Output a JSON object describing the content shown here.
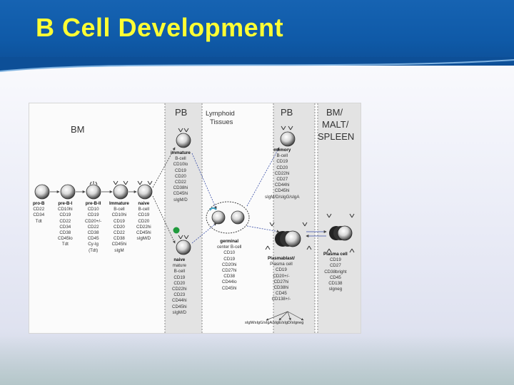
{
  "slide": {
    "title": "B Cell Development",
    "colors": {
      "header": "#1060ae",
      "title": "#ffff33",
      "panel_shade": "#e2e2e2"
    }
  },
  "diagram": {
    "columns": {
      "bm": "BM",
      "pb1": "PB",
      "lymphoid_1": "Lymphoid",
      "lymphoid_2": "Tissues",
      "pb2": "PB",
      "end_1": "BM/",
      "end_2": "MALT/",
      "end_3": "SPLEEN"
    },
    "stages": {
      "pro_b": [
        "pro-B",
        "CD22",
        "CD34",
        "Tdt"
      ],
      "pre_b1": [
        "pre-B-I",
        "CD10hi",
        "CD19",
        "CD22",
        "CD34",
        "CD38",
        "CD45lo",
        "Tdt"
      ],
      "pre_b2": [
        "pre-B-II",
        "CD10",
        "CD19",
        "CD20+/-",
        "CD22",
        "CD38",
        "CD45",
        "Cy-Ig",
        "(Tdt)"
      ],
      "immature_bm": [
        "Immature",
        "B-cell",
        "CD10hi",
        "CD19",
        "CD20",
        "CD22",
        "CD38",
        "CD45hi",
        "sIgM"
      ],
      "naive_bm": [
        "naive",
        "B-cell",
        "CD19",
        "CD20",
        "CD22hi",
        "CD45hi",
        "sIgM/D"
      ],
      "immature_pb": [
        "immature",
        "B-cell",
        "CD10lo",
        "CD19",
        "CD20",
        "CD22",
        "CD38hi",
        "CD45hi",
        "sIgM/D"
      ],
      "naive_pb": [
        "naive",
        "mature",
        "B-cell",
        "CD19",
        "CD20",
        "CD22hi",
        "CD23",
        "CD44hi",
        "CD45hi",
        "sIgM/D"
      ],
      "germinal": [
        "germinal",
        "center B-cell",
        "CD10",
        "CD19",
        "CD20hi",
        "CD27hi",
        "CD38",
        "CD44lo",
        "CD45hi"
      ],
      "memory": [
        "memory",
        "B-cell",
        "CD19",
        "CD20",
        "CD22hi",
        "CD27",
        "CD44hi",
        "CD45hi",
        "sIgM/D/sIgG/sIgA"
      ],
      "plasmablast": [
        "Plasmablast/",
        "Plasma cell",
        "CD19",
        "CD20+/-",
        "CD27hi",
        "CD38hi",
        "CD45",
        "CD138+/-"
      ],
      "plasma": [
        "Plasma cell",
        "CD19",
        "CD27",
        "CD38bright",
        "CD45",
        "CD138",
        "sIgneg"
      ]
    },
    "isotypes": "sIgM/sIgG/sIgA/sIgE/sIgD/sIgneg"
  }
}
